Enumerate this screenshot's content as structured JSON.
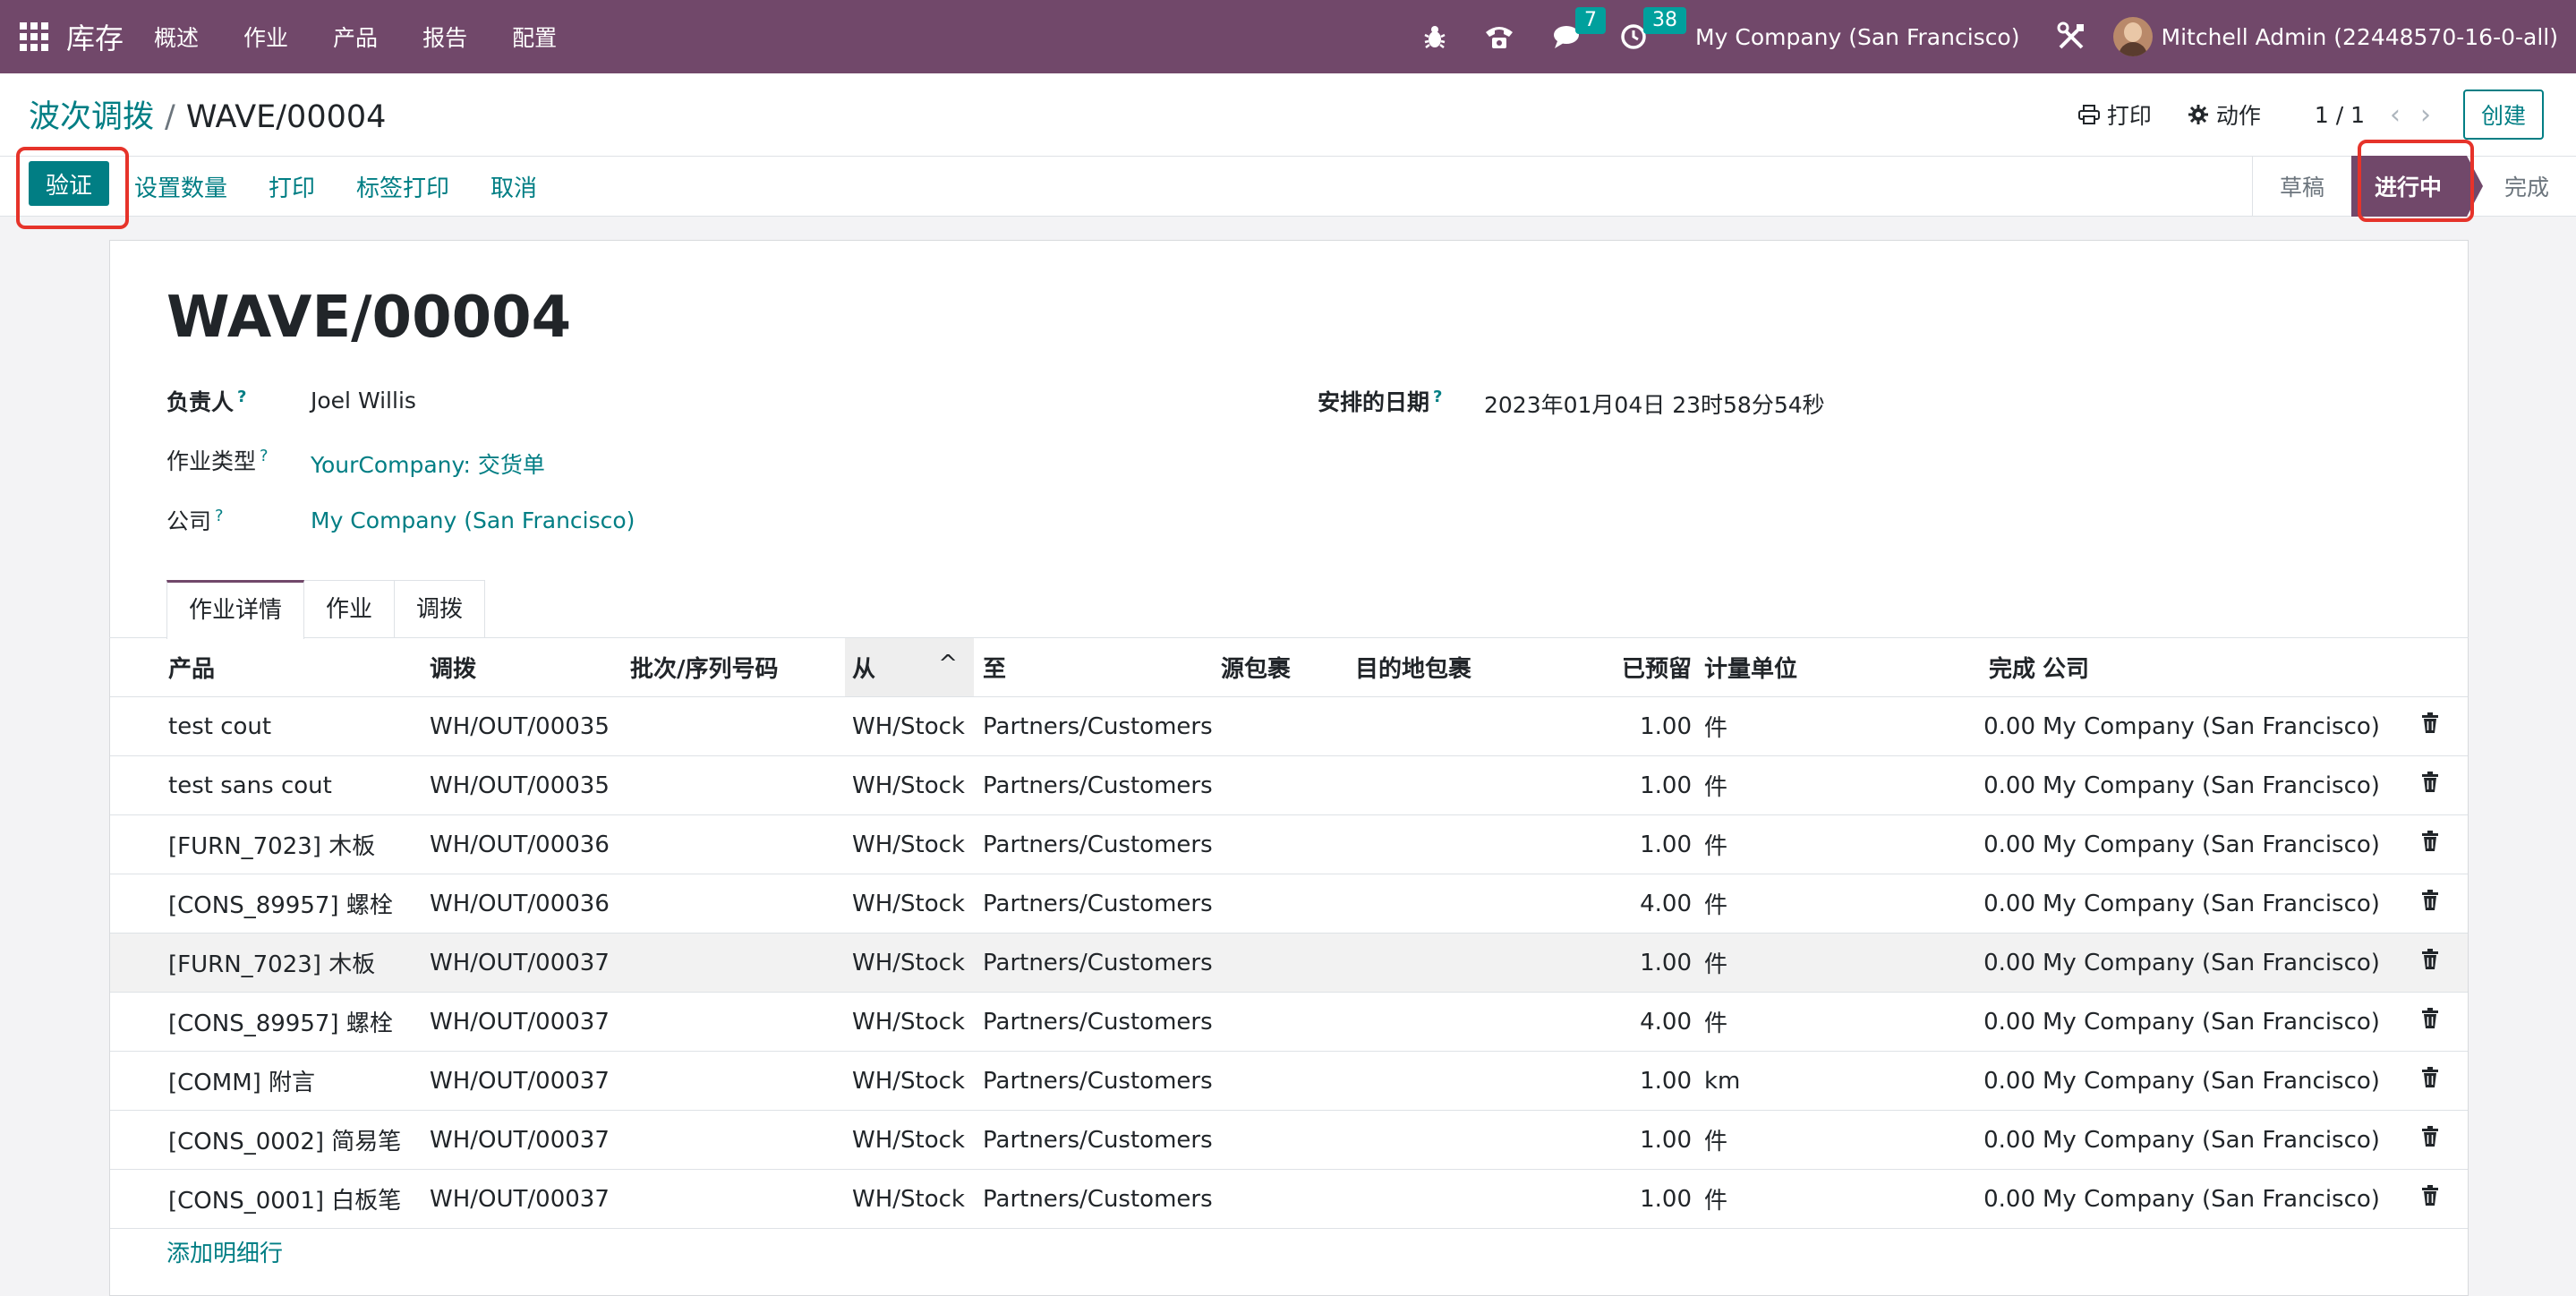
{
  "nav": {
    "brand": "库存",
    "menus": [
      "概述",
      "作业",
      "产品",
      "报告",
      "配置"
    ],
    "messages_count": "7",
    "activities_count": "38",
    "company": "My Company (San Francisco)",
    "user": "Mitchell Admin (22448570-16-0-all)"
  },
  "breadcrumb": {
    "parent": "波次调拨",
    "separator": "/",
    "current": "WAVE/00004"
  },
  "top_actions": {
    "print": "打印",
    "action": "动作",
    "pager": "1 / 1",
    "create": "创建"
  },
  "statusbar": {
    "validate": "验证",
    "buttons": [
      "设置数量",
      "打印",
      "标签打印",
      "取消"
    ],
    "stages": [
      "草稿",
      "进行中",
      "完成"
    ]
  },
  "form": {
    "title": "WAVE/00004",
    "responsible_label": "负责人",
    "responsible": "Joel Willis",
    "operation_type_label": "作业类型",
    "operation_type": "YourCompany: 交货单",
    "company_label": "公司",
    "company": "My Company (San Francisco)",
    "scheduled_label": "安排的日期",
    "scheduled": "2023年01月04日 23时58分54秒",
    "help_mark": "?"
  },
  "tabs": [
    "作业详情",
    "作业",
    "调拨"
  ],
  "table": {
    "headers": [
      "产品",
      "调拨",
      "批次/序列号码",
      "从",
      "至",
      "源包裹",
      "目的地包裹",
      "已预留",
      "计量单位",
      "完成",
      "公司"
    ],
    "rows": [
      {
        "product": "test cout",
        "transfer": "WH/OUT/00035",
        "lot": "",
        "from": "WH/Stock",
        "to": "Partners/Customers",
        "src_pkg": "",
        "dst_pkg": "",
        "reserved": "1.00",
        "uom": "件",
        "done": "0.00",
        "company": "My Company (San Francisco)"
      },
      {
        "product": "test sans cout",
        "transfer": "WH/OUT/00035",
        "lot": "",
        "from": "WH/Stock",
        "to": "Partners/Customers",
        "src_pkg": "",
        "dst_pkg": "",
        "reserved": "1.00",
        "uom": "件",
        "done": "0.00",
        "company": "My Company (San Francisco)"
      },
      {
        "product": "[FURN_7023] 木板",
        "transfer": "WH/OUT/00036",
        "lot": "",
        "from": "WH/Stock",
        "to": "Partners/Customers",
        "src_pkg": "",
        "dst_pkg": "",
        "reserved": "1.00",
        "uom": "件",
        "done": "0.00",
        "company": "My Company (San Francisco)"
      },
      {
        "product": "[CONS_89957] 螺栓",
        "transfer": "WH/OUT/00036",
        "lot": "",
        "from": "WH/Stock",
        "to": "Partners/Customers",
        "src_pkg": "",
        "dst_pkg": "",
        "reserved": "4.00",
        "uom": "件",
        "done": "0.00",
        "company": "My Company (San Francisco)"
      },
      {
        "product": "[FURN_7023] 木板",
        "transfer": "WH/OUT/00037",
        "lot": "",
        "from": "WH/Stock",
        "to": "Partners/Customers",
        "src_pkg": "",
        "dst_pkg": "",
        "reserved": "1.00",
        "uom": "件",
        "done": "0.00",
        "company": "My Company (San Francisco)"
      },
      {
        "product": "[CONS_89957] 螺栓",
        "transfer": "WH/OUT/00037",
        "lot": "",
        "from": "WH/Stock",
        "to": "Partners/Customers",
        "src_pkg": "",
        "dst_pkg": "",
        "reserved": "4.00",
        "uom": "件",
        "done": "0.00",
        "company": "My Company (San Francisco)"
      },
      {
        "product": "[COMM] 附言",
        "transfer": "WH/OUT/00037",
        "lot": "",
        "from": "WH/Stock",
        "to": "Partners/Customers",
        "src_pkg": "",
        "dst_pkg": "",
        "reserved": "1.00",
        "uom": "km",
        "done": "0.00",
        "company": "My Company (San Francisco)"
      },
      {
        "product": "[CONS_0002] 简易笔",
        "transfer": "WH/OUT/00037",
        "lot": "",
        "from": "WH/Stock",
        "to": "Partners/Customers",
        "src_pkg": "",
        "dst_pkg": "",
        "reserved": "1.00",
        "uom": "件",
        "done": "0.00",
        "company": "My Company (San Francisco)"
      },
      {
        "product": "[CONS_0001] 白板笔",
        "transfer": "WH/OUT/00037",
        "lot": "",
        "from": "WH/Stock",
        "to": "Partners/Customers",
        "src_pkg": "",
        "dst_pkg": "",
        "reserved": "1.00",
        "uom": "件",
        "done": "0.00",
        "company": "My Company (San Francisco)"
      }
    ],
    "add_line": "添加明细行"
  },
  "colors": {
    "navbar": "#71486a",
    "primary": "#017e84",
    "badge": "#00a09d",
    "highlight": "#e6332a"
  }
}
